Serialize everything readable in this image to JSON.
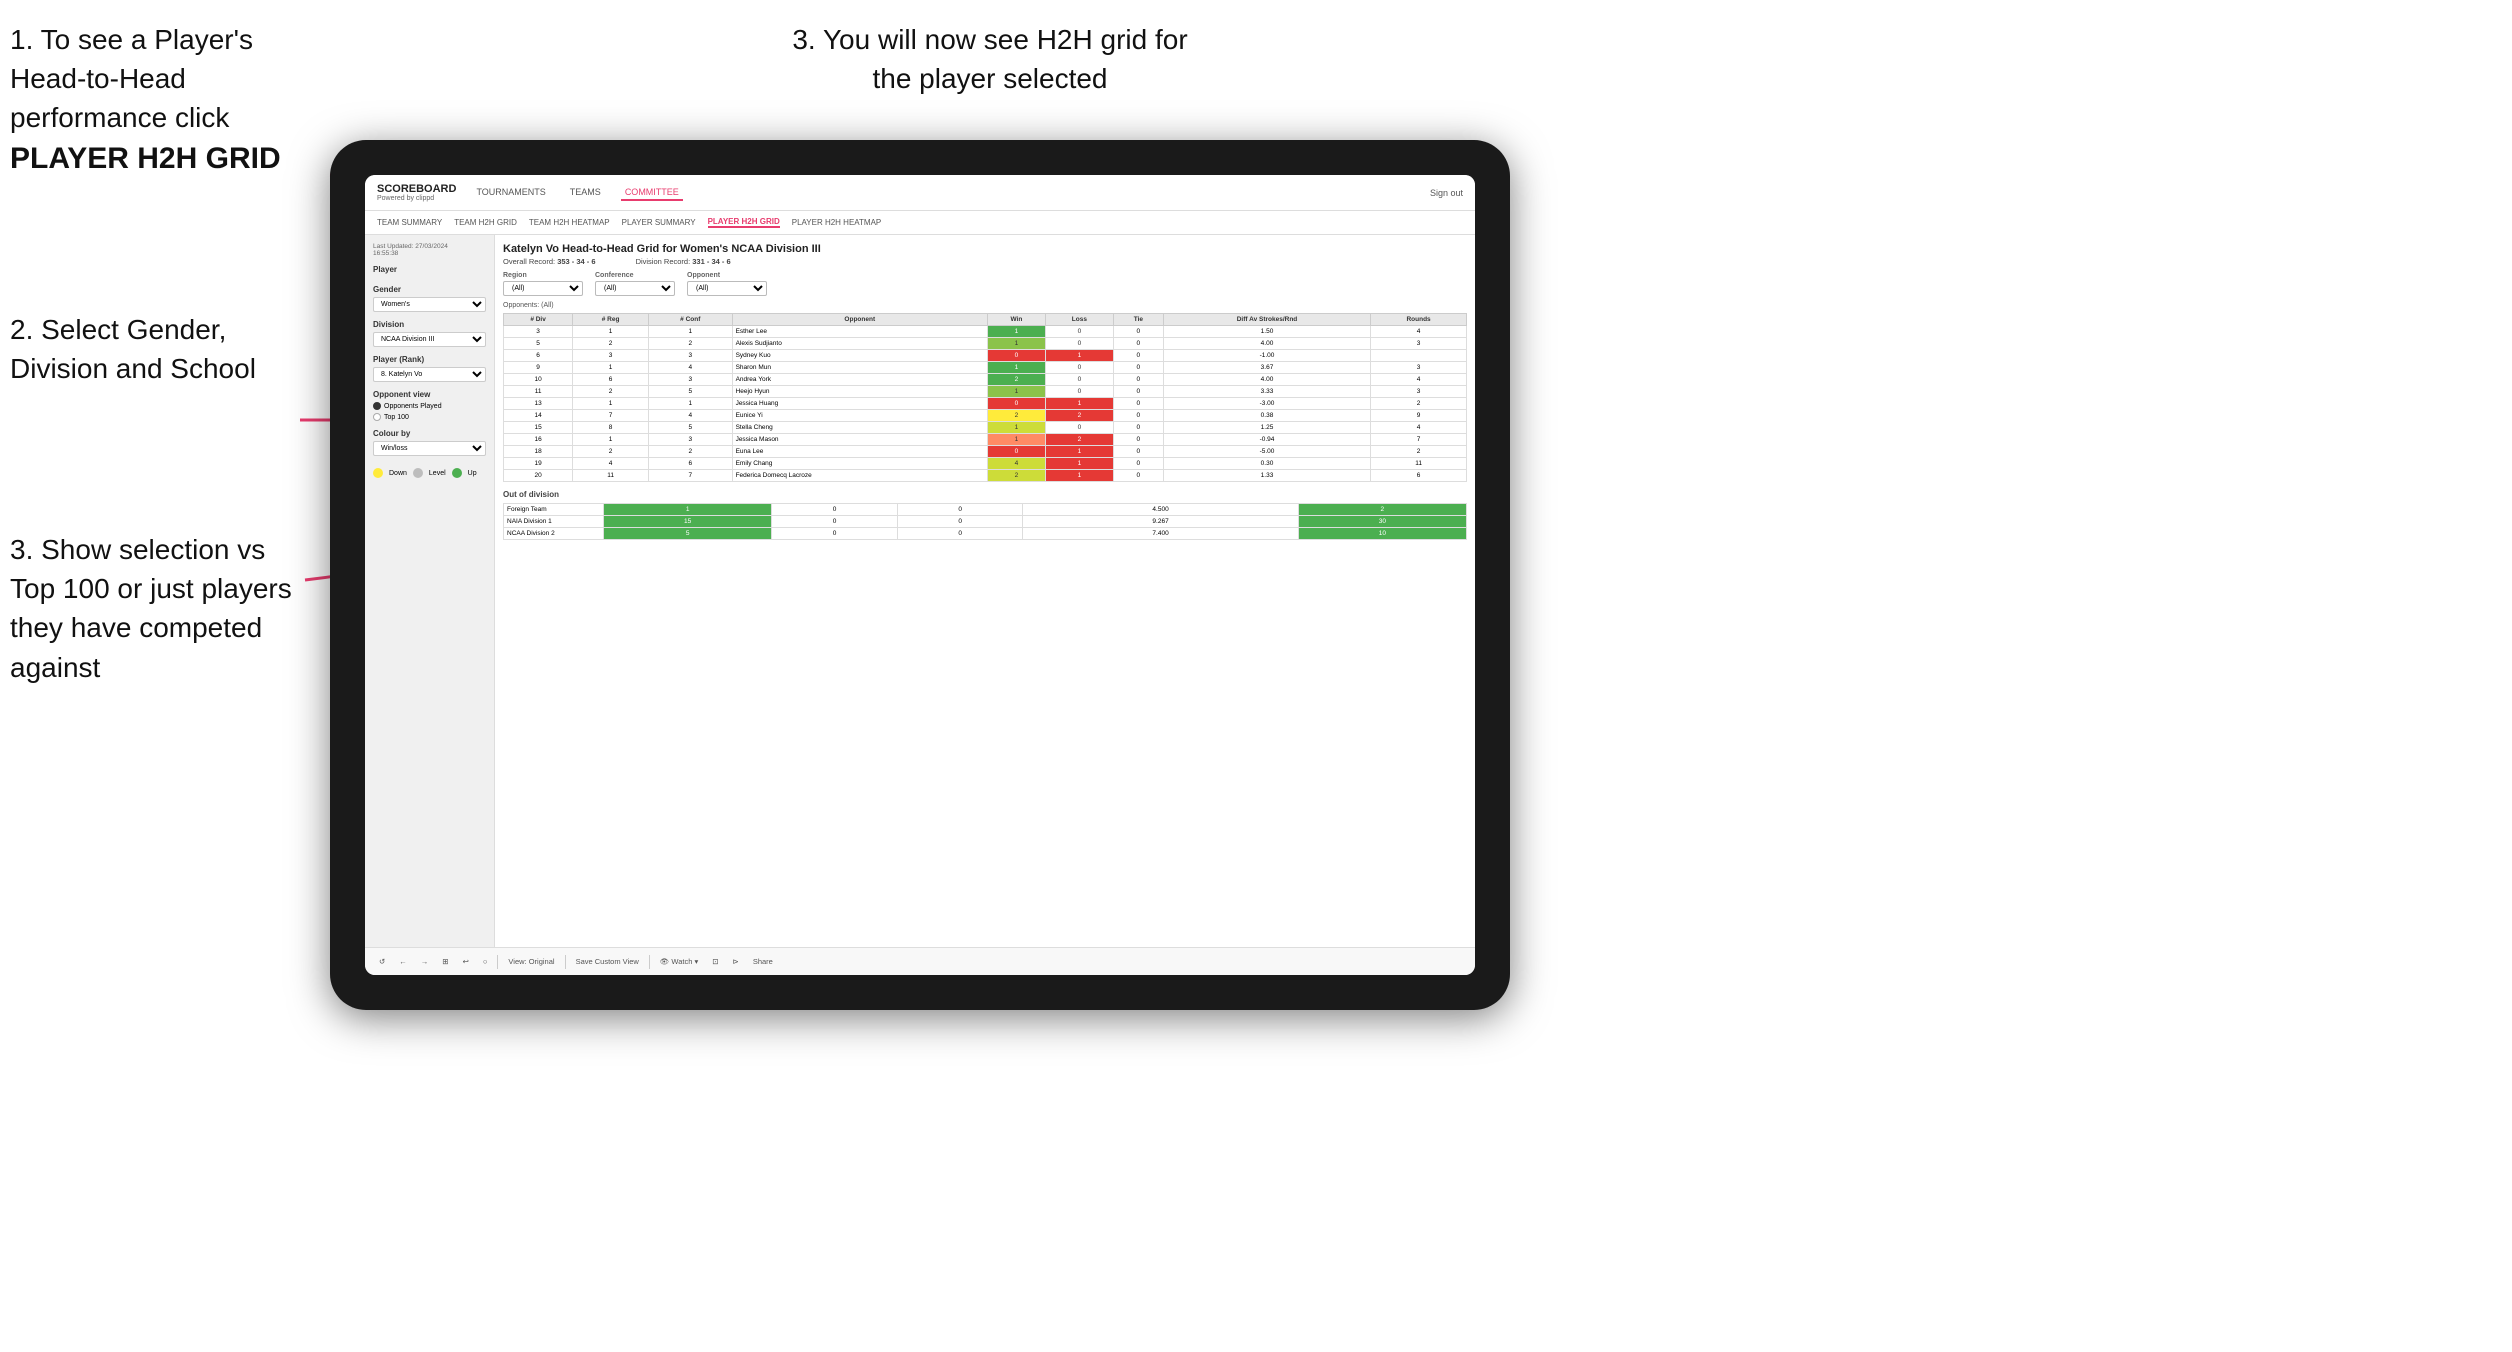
{
  "page": {
    "instructions": {
      "top_left_1": "1. To see a Player's Head-to-Head performance click",
      "top_left_bold": "PLAYER H2H GRID",
      "top_right": "3. You will now see H2H grid for the player selected",
      "mid_left_label": "2. Select Gender, Division and School",
      "bot_left_label": "3. Show selection vs Top 100 or just players they have competed against"
    },
    "nav": {
      "logo": "SCOREBOARD",
      "logo_sub": "Powered by clippd",
      "links": [
        "TOURNAMENTS",
        "TEAMS",
        "COMMITTEE"
      ],
      "active_link": "COMMITTEE",
      "sign_out": "Sign out"
    },
    "sub_nav": {
      "links": [
        "TEAM SUMMARY",
        "TEAM H2H GRID",
        "TEAM H2H HEATMAP",
        "PLAYER SUMMARY",
        "PLAYER H2H GRID",
        "PLAYER H2H HEATMAP"
      ],
      "active": "PLAYER H2H GRID"
    },
    "left_panel": {
      "timestamp": "Last Updated: 27/03/2024",
      "timestamp2": "16:55:38",
      "player_label": "Player",
      "gender_label": "Gender",
      "gender_value": "Women's",
      "division_label": "Division",
      "division_value": "NCAA Division III",
      "player_rank_label": "Player (Rank)",
      "player_rank_value": "8. Katelyn Vo",
      "opponent_view_label": "Opponent view",
      "radio1": "Opponents Played",
      "radio2": "Top 100",
      "colour_by_label": "Colour by",
      "colour_by_value": "Win/loss",
      "legend": {
        "down_label": "Down",
        "level_label": "Level",
        "up_label": "Up"
      }
    },
    "grid": {
      "title": "Katelyn Vo Head-to-Head Grid for Women's NCAA Division III",
      "overall_record_label": "Overall Record:",
      "overall_record": "353 - 34 - 6",
      "division_record_label": "Division Record:",
      "division_record": "331 - 34 - 6",
      "region_filter_label": "Region",
      "conference_filter_label": "Conference",
      "opponent_filter_label": "Opponent",
      "opponents_label": "Opponents:",
      "all_label": "(All)",
      "table_headers": {
        "div": "# Div",
        "reg": "# Reg",
        "conf": "# Conf",
        "opponent": "Opponent",
        "win": "Win",
        "loss": "Loss",
        "tie": "Tie",
        "diff": "Diff Av Strokes/Rnd",
        "rounds": "Rounds"
      },
      "rows": [
        {
          "div": 3,
          "reg": 1,
          "conf": 1,
          "opponent": "Esther Lee",
          "win": 1,
          "loss": 0,
          "tie": 0,
          "diff": "1.50",
          "rounds": 4,
          "win_color": "green-dark"
        },
        {
          "div": 5,
          "reg": 2,
          "conf": 2,
          "opponent": "Alexis Sudjianto",
          "win": 1,
          "loss": 0,
          "tie": 0,
          "diff": "4.00",
          "rounds": 3,
          "win_color": "green-mid"
        },
        {
          "div": 6,
          "reg": 3,
          "conf": 3,
          "opponent": "Sydney Kuo",
          "win": 0,
          "loss": 1,
          "tie": 0,
          "diff": "-1.00",
          "rounds": "",
          "win_color": "red"
        },
        {
          "div": 9,
          "reg": 1,
          "conf": 4,
          "opponent": "Sharon Mun",
          "win": 1,
          "loss": 0,
          "tie": 0,
          "diff": "3.67",
          "rounds": 3,
          "win_color": "green-dark"
        },
        {
          "div": 10,
          "reg": 6,
          "conf": 3,
          "opponent": "Andrea York",
          "win": 2,
          "loss": 0,
          "tie": 0,
          "diff": "4.00",
          "rounds": 4,
          "win_color": "green-dark"
        },
        {
          "div": 11,
          "reg": 2,
          "conf": 5,
          "opponent": "Heejo Hyun",
          "win": 1,
          "loss": 0,
          "tie": 0,
          "diff": "3.33",
          "rounds": 3,
          "win_color": "green-mid"
        },
        {
          "div": 13,
          "reg": 1,
          "conf": 1,
          "opponent": "Jessica Huang",
          "win": 0,
          "loss": 1,
          "tie": 0,
          "diff": "-3.00",
          "rounds": 2,
          "win_color": "red"
        },
        {
          "div": 14,
          "reg": 7,
          "conf": 4,
          "opponent": "Eunice Yi",
          "win": 2,
          "loss": 2,
          "tie": 0,
          "diff": "0.38",
          "rounds": 9,
          "win_color": "yellow"
        },
        {
          "div": 15,
          "reg": 8,
          "conf": 5,
          "opponent": "Stella Cheng",
          "win": 1,
          "loss": 0,
          "tie": 0,
          "diff": "1.25",
          "rounds": 4,
          "win_color": "green-light"
        },
        {
          "div": 16,
          "reg": 1,
          "conf": 3,
          "opponent": "Jessica Mason",
          "win": 1,
          "loss": 2,
          "tie": 0,
          "diff": "-0.94",
          "rounds": 7,
          "win_color": "red-light"
        },
        {
          "div": 18,
          "reg": 2,
          "conf": 2,
          "opponent": "Euna Lee",
          "win": 0,
          "loss": 1,
          "tie": 0,
          "diff": "-5.00",
          "rounds": 2,
          "win_color": "red"
        },
        {
          "div": 19,
          "reg": 4,
          "conf": 6,
          "opponent": "Emily Chang",
          "win": 4,
          "loss": 1,
          "tie": 0,
          "diff": "0.30",
          "rounds": 11,
          "win_color": "green-light"
        },
        {
          "div": 20,
          "reg": 11,
          "conf": 7,
          "opponent": "Federica Domecq Lacroze",
          "win": 2,
          "loss": 1,
          "tie": 0,
          "diff": "1.33",
          "rounds": 6,
          "win_color": "green-light"
        }
      ],
      "out_of_division_label": "Out of division",
      "out_of_division_rows": [
        {
          "name": "Foreign Team",
          "win": 1,
          "loss": 0,
          "tie": 0,
          "diff": "4.500",
          "rounds": 2,
          "color": "green-dark"
        },
        {
          "name": "NAIA Division 1",
          "win": 15,
          "loss": 0,
          "tie": 0,
          "diff": "9.267",
          "rounds": 30,
          "color": "green-dark"
        },
        {
          "name": "NCAA Division 2",
          "win": 5,
          "loss": 0,
          "tie": 0,
          "diff": "7.400",
          "rounds": 10,
          "color": "green-dark"
        }
      ]
    },
    "toolbar": {
      "buttons": [
        "↺",
        "←",
        "→",
        "⊞",
        "↩",
        "○",
        "View: Original",
        "Save Custom View",
        "👁 Watch ▾",
        "⊡",
        "⊳",
        "Share"
      ]
    }
  }
}
